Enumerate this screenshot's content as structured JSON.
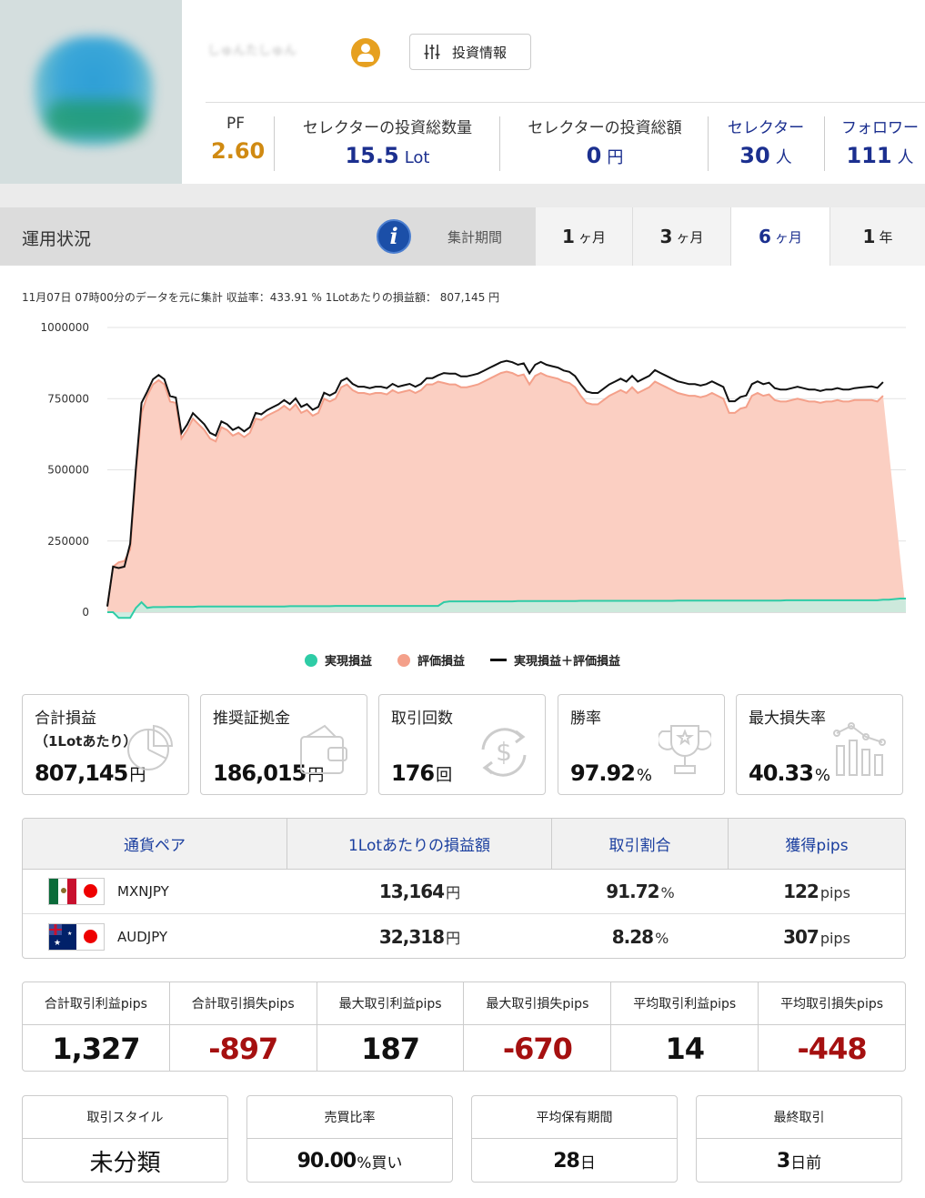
{
  "profile": {
    "username": "しゅんたしゅん",
    "invest_button": "投資情報"
  },
  "stats": {
    "pf": {
      "label": "PF",
      "value": "2.60",
      "color": "#d08a12"
    },
    "lots": {
      "label": "セレクターの投資総数量",
      "value": "15.5",
      "unit": "Lot"
    },
    "amount": {
      "label": "セレクターの投資総額",
      "value": "0",
      "unit": "円"
    },
    "selectors": {
      "label": "セレクター",
      "value": "30",
      "unit": "人"
    },
    "followers": {
      "label": "フォロワー",
      "value": "111",
      "unit": "人"
    }
  },
  "tabs_bar": {
    "title": "運用状況",
    "period_label": "集計期間",
    "tabs": [
      {
        "num": "1",
        "unit": "ヶ月",
        "active": false
      },
      {
        "num": "3",
        "unit": "ヶ月",
        "active": false
      },
      {
        "num": "6",
        "unit": "ヶ月",
        "active": true
      },
      {
        "num": "1",
        "unit": "年",
        "active": false
      }
    ]
  },
  "caption": "11月07日 07時00分のデータを元に集計 収益率：433.91 % 1Lotあたりの損益額： 807,145 円",
  "chart_data": {
    "type": "area",
    "ylim": [
      0,
      1000000
    ],
    "yticks": [
      "0",
      "250000",
      "500000",
      "750000",
      "1000000"
    ],
    "grid": true,
    "legend_position": "bottom",
    "colors": {
      "realized": "#2ecca6",
      "unrealized": "#f4a08a",
      "total": "#111111"
    },
    "series": [
      {
        "name": "実現損益",
        "values": [
          0,
          0,
          -20000,
          -20000,
          -20000,
          15000,
          35000,
          15000,
          18000,
          18000,
          18000,
          19000,
          19000,
          19000,
          19000,
          19000,
          20000,
          20000,
          20000,
          20000,
          20000,
          20000,
          20000,
          20000,
          20000,
          20000,
          20000,
          20000,
          20000,
          20000,
          20000,
          20000,
          21000,
          21000,
          21000,
          21000,
          21000,
          21000,
          21000,
          21000,
          22000,
          22000,
          22000,
          22000,
          22000,
          22000,
          22000,
          22000,
          22000,
          22000,
          22000,
          22000,
          22000,
          22000,
          22000,
          22000,
          22000,
          22000,
          22000,
          35000,
          38000,
          38000,
          38000,
          38000,
          38000,
          38000,
          38000,
          38000,
          38000,
          38000,
          38000,
          38000,
          39000,
          39000,
          39000,
          39000,
          39000,
          39000,
          39000,
          39000,
          39000,
          39000,
          39000,
          40000,
          40000,
          40000,
          40000,
          40000,
          40000,
          40000,
          40000,
          40000,
          40000,
          40000,
          40000,
          40000,
          40000,
          40000,
          40000,
          40000,
          41000,
          41000,
          41000,
          41000,
          41000,
          41000,
          41000,
          41000,
          41000,
          41000,
          41000,
          41000,
          41000,
          41000,
          41000,
          41000,
          41000,
          41000,
          41000,
          42000,
          42000,
          42000,
          42000,
          42000,
          42000,
          42000,
          42000,
          42000,
          42000,
          42000,
          42000,
          42000,
          42000,
          42000,
          42000,
          42000,
          44000,
          44000,
          46000,
          48000,
          48000
        ]
      },
      {
        "name": "評価損益",
        "values": [
          20000,
          160000,
          175000,
          180000,
          220000,
          490000,
          700000,
          760000,
          800000,
          815000,
          800000,
          740000,
          735000,
          610000,
          640000,
          680000,
          660000,
          640000,
          610000,
          600000,
          650000,
          640000,
          620000,
          630000,
          615000,
          630000,
          680000,
          675000,
          690000,
          700000,
          710000,
          725000,
          710000,
          730000,
          700000,
          710000,
          690000,
          700000,
          750000,
          740000,
          750000,
          790000,
          800000,
          780000,
          770000,
          770000,
          765000,
          770000,
          770000,
          765000,
          780000,
          770000,
          775000,
          780000,
          770000,
          780000,
          800000,
          800000,
          810000,
          805000,
          800000,
          800000,
          790000,
          790000,
          795000,
          800000,
          810000,
          820000,
          830000,
          840000,
          845000,
          840000,
          830000,
          835000,
          800000,
          830000,
          840000,
          830000,
          825000,
          820000,
          810000,
          805000,
          790000,
          760000,
          735000,
          730000,
          730000,
          745000,
          760000,
          770000,
          780000,
          770000,
          790000,
          770000,
          780000,
          790000,
          810000,
          800000,
          790000,
          780000,
          770000,
          765000,
          760000,
          760000,
          755000,
          760000,
          770000,
          760000,
          750000,
          700000,
          700000,
          715000,
          720000,
          760000,
          770000,
          760000,
          765000,
          745000,
          740000,
          740000,
          745000,
          750000,
          745000,
          740000,
          740000,
          735000,
          740000,
          740000,
          745000,
          740000,
          740000,
          745000,
          745000,
          745000,
          745000,
          740000,
          760000
        ]
      },
      {
        "name": "実現損益＋評価損益",
        "values": [
          20000,
          160000,
          155000,
          160000,
          240000,
          505000,
          735000,
          775000,
          818000,
          833000,
          818000,
          759000,
          754000,
          629000,
          659000,
          699000,
          680000,
          660000,
          630000,
          620000,
          670000,
          660000,
          640000,
          650000,
          635000,
          650000,
          700000,
          695000,
          710000,
          720000,
          730000,
          745000,
          731000,
          751000,
          721000,
          731000,
          711000,
          721000,
          771000,
          761000,
          772000,
          812000,
          822000,
          802000,
          792000,
          792000,
          787000,
          792000,
          792000,
          787000,
          802000,
          792000,
          797000,
          802000,
          792000,
          802000,
          822000,
          822000,
          832000,
          840000,
          838000,
          838000,
          828000,
          828000,
          833000,
          838000,
          848000,
          858000,
          868000,
          878000,
          883000,
          878000,
          869000,
          874000,
          839000,
          869000,
          879000,
          869000,
          864000,
          859000,
          849000,
          844000,
          829000,
          800000,
          775000,
          770000,
          770000,
          785000,
          800000,
          810000,
          820000,
          810000,
          830000,
          810000,
          820000,
          830000,
          850000,
          840000,
          830000,
          820000,
          811000,
          806000,
          801000,
          801000,
          796000,
          801000,
          811000,
          801000,
          791000,
          741000,
          741000,
          756000,
          761000,
          801000,
          811000,
          801000,
          806000,
          787000,
          782000,
          782000,
          787000,
          792000,
          787000,
          782000,
          782000,
          777000,
          782000,
          782000,
          787000,
          782000,
          782000,
          787000,
          789000,
          791000,
          793000,
          788000,
          808000
        ]
      }
    ]
  },
  "cards": [
    {
      "title": "合計損益",
      "sub": "（1Lotあたり）",
      "value": "807,145",
      "unit": "円",
      "icon": "pie-chart-icon"
    },
    {
      "title": "推奨証拠金",
      "sub": "",
      "value": "186,015",
      "unit": "円",
      "icon": "wallet-icon"
    },
    {
      "title": "取引回数",
      "sub": "",
      "value": "176",
      "unit": "回",
      "icon": "dollar-cycle-icon"
    },
    {
      "title": "勝率",
      "sub": "",
      "value": "97.92",
      "unit": "%",
      "icon": "trophy-icon"
    },
    {
      "title": "最大損失率",
      "sub": "",
      "value": "40.33",
      "unit": "%",
      "icon": "bar-chart-icon"
    }
  ],
  "pair_table": {
    "headers": [
      "通貨ペア",
      "1Lotあたりの損益額",
      "取引割合",
      "獲得pips"
    ],
    "rows": [
      {
        "pair": "MXNJPY",
        "pl": "13,164",
        "pl_unit": "円",
        "ratio": "91.72",
        "ratio_unit": "%",
        "pips": "122",
        "pips_unit": "pips"
      },
      {
        "pair": "AUDJPY",
        "pl": "32,318",
        "pl_unit": "円",
        "ratio": "8.28",
        "ratio_unit": "%",
        "pips": "307",
        "pips_unit": "pips"
      }
    ]
  },
  "pips": [
    {
      "label": "合計取引利益pips",
      "value": "1,327",
      "negative": false
    },
    {
      "label": "合計取引損失pips",
      "value": "-897",
      "negative": true
    },
    {
      "label": "最大取引利益pips",
      "value": "187",
      "negative": false
    },
    {
      "label": "最大取引損失pips",
      "value": "-670",
      "negative": true
    },
    {
      "label": "平均取引利益pips",
      "value": "14",
      "negative": false
    },
    {
      "label": "平均取引損失pips",
      "value": "-448",
      "negative": true
    }
  ],
  "bottom": [
    {
      "label": "取引スタイル",
      "value": "未分類",
      "unit": ""
    },
    {
      "label": "売買比率",
      "value": "90.00",
      "unit": "%買い"
    },
    {
      "label": "平均保有期間",
      "value": "28",
      "unit": "日"
    },
    {
      "label": "最終取引",
      "value": "3",
      "unit": "日前"
    }
  ]
}
